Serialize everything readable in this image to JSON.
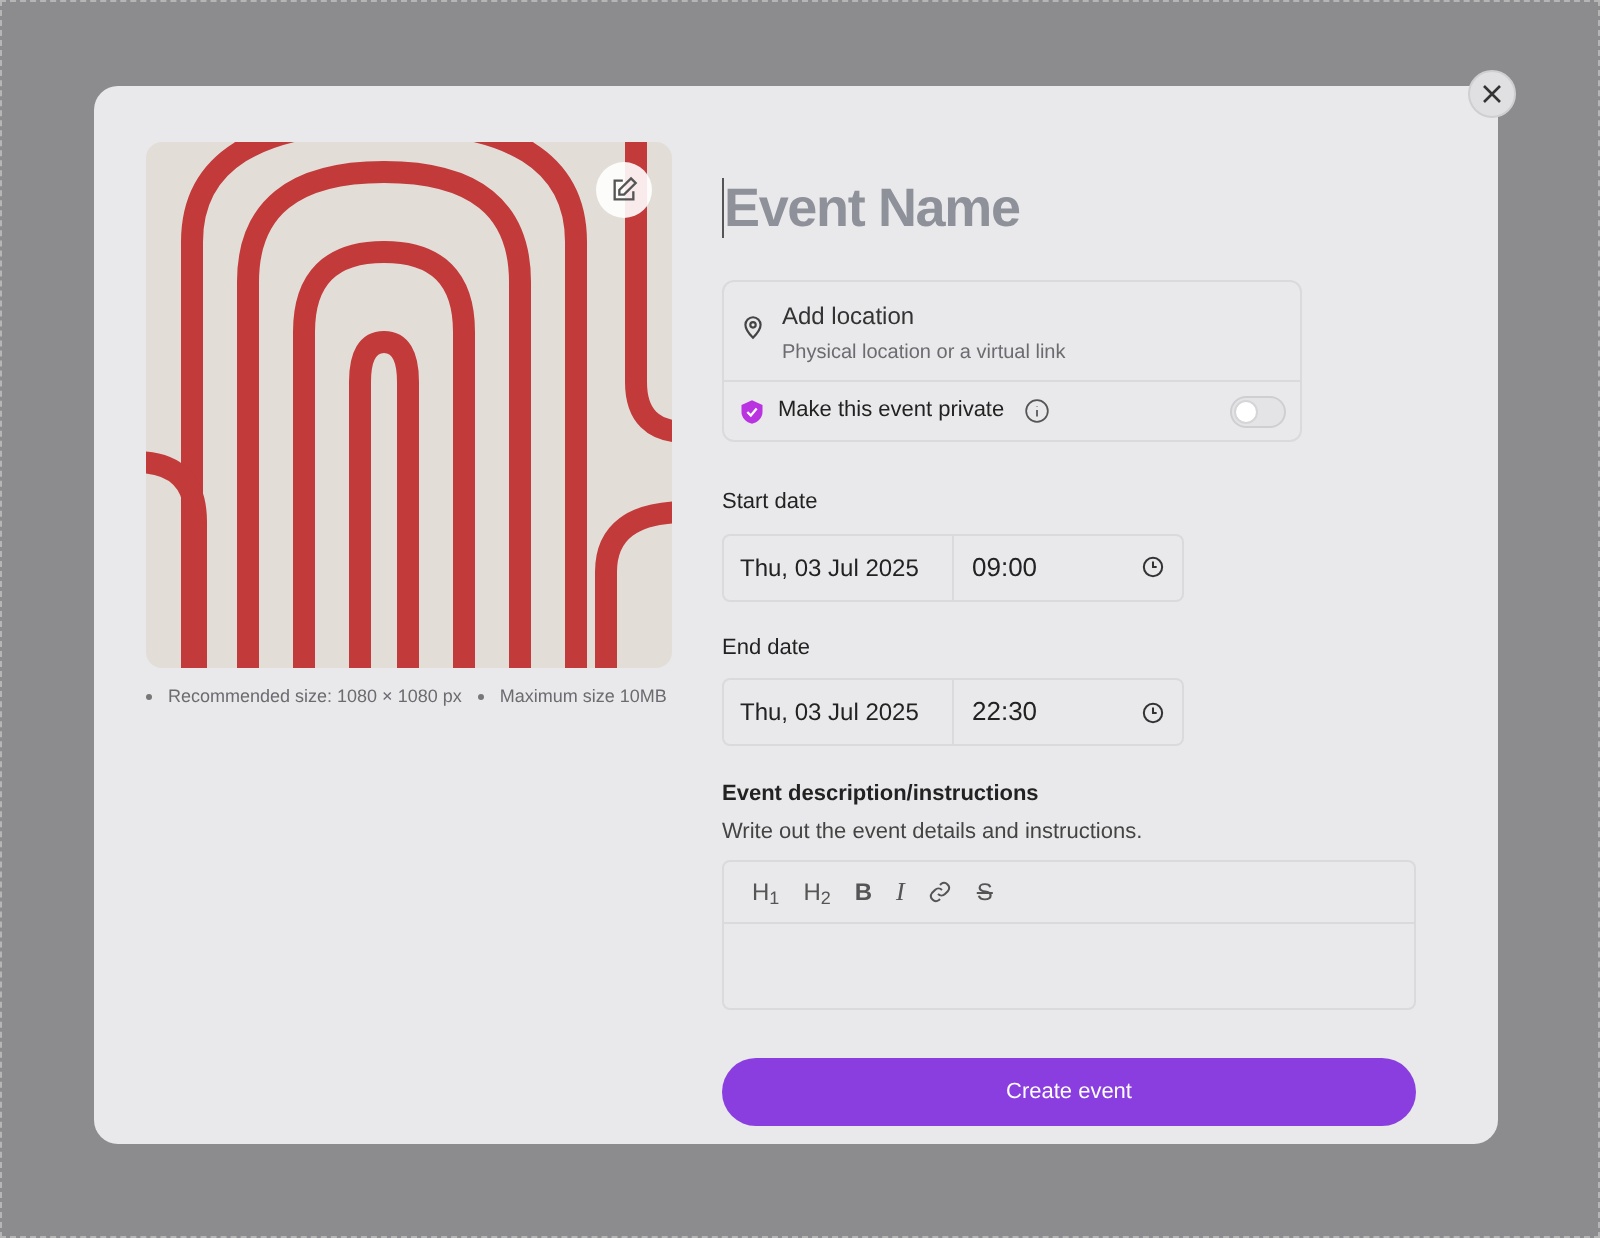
{
  "cover_image": {
    "notes": [
      "Recommended size: 1080 × 1080 px",
      "Maximum size 10MB"
    ]
  },
  "event_name": {
    "placeholder": "Event Name"
  },
  "location": {
    "title": "Add location",
    "hint": "Physical location or a virtual link"
  },
  "private": {
    "label": "Make this event private",
    "on": false
  },
  "start": {
    "label": "Start date",
    "date": "Thu, 03 Jul 2025",
    "time": "09:00"
  },
  "end": {
    "label": "End date",
    "date": "Thu, 03 Jul 2025",
    "time": "22:30"
  },
  "description": {
    "label": "Event description/instructions",
    "hint": "Write out the event details and instructions.",
    "tools": [
      {
        "kind": "text",
        "label": "H$_{1}$"
      },
      {
        "kind": "text",
        "label": "H$_{2}$"
      },
      {
        "kind": "bold",
        "label": "B"
      },
      {
        "kind": "italic",
        "label": "I"
      },
      {
        "kind": "link"
      },
      {
        "kind": "strike",
        "label": "S"
      }
    ]
  },
  "submit": {
    "label": "Create event"
  }
}
